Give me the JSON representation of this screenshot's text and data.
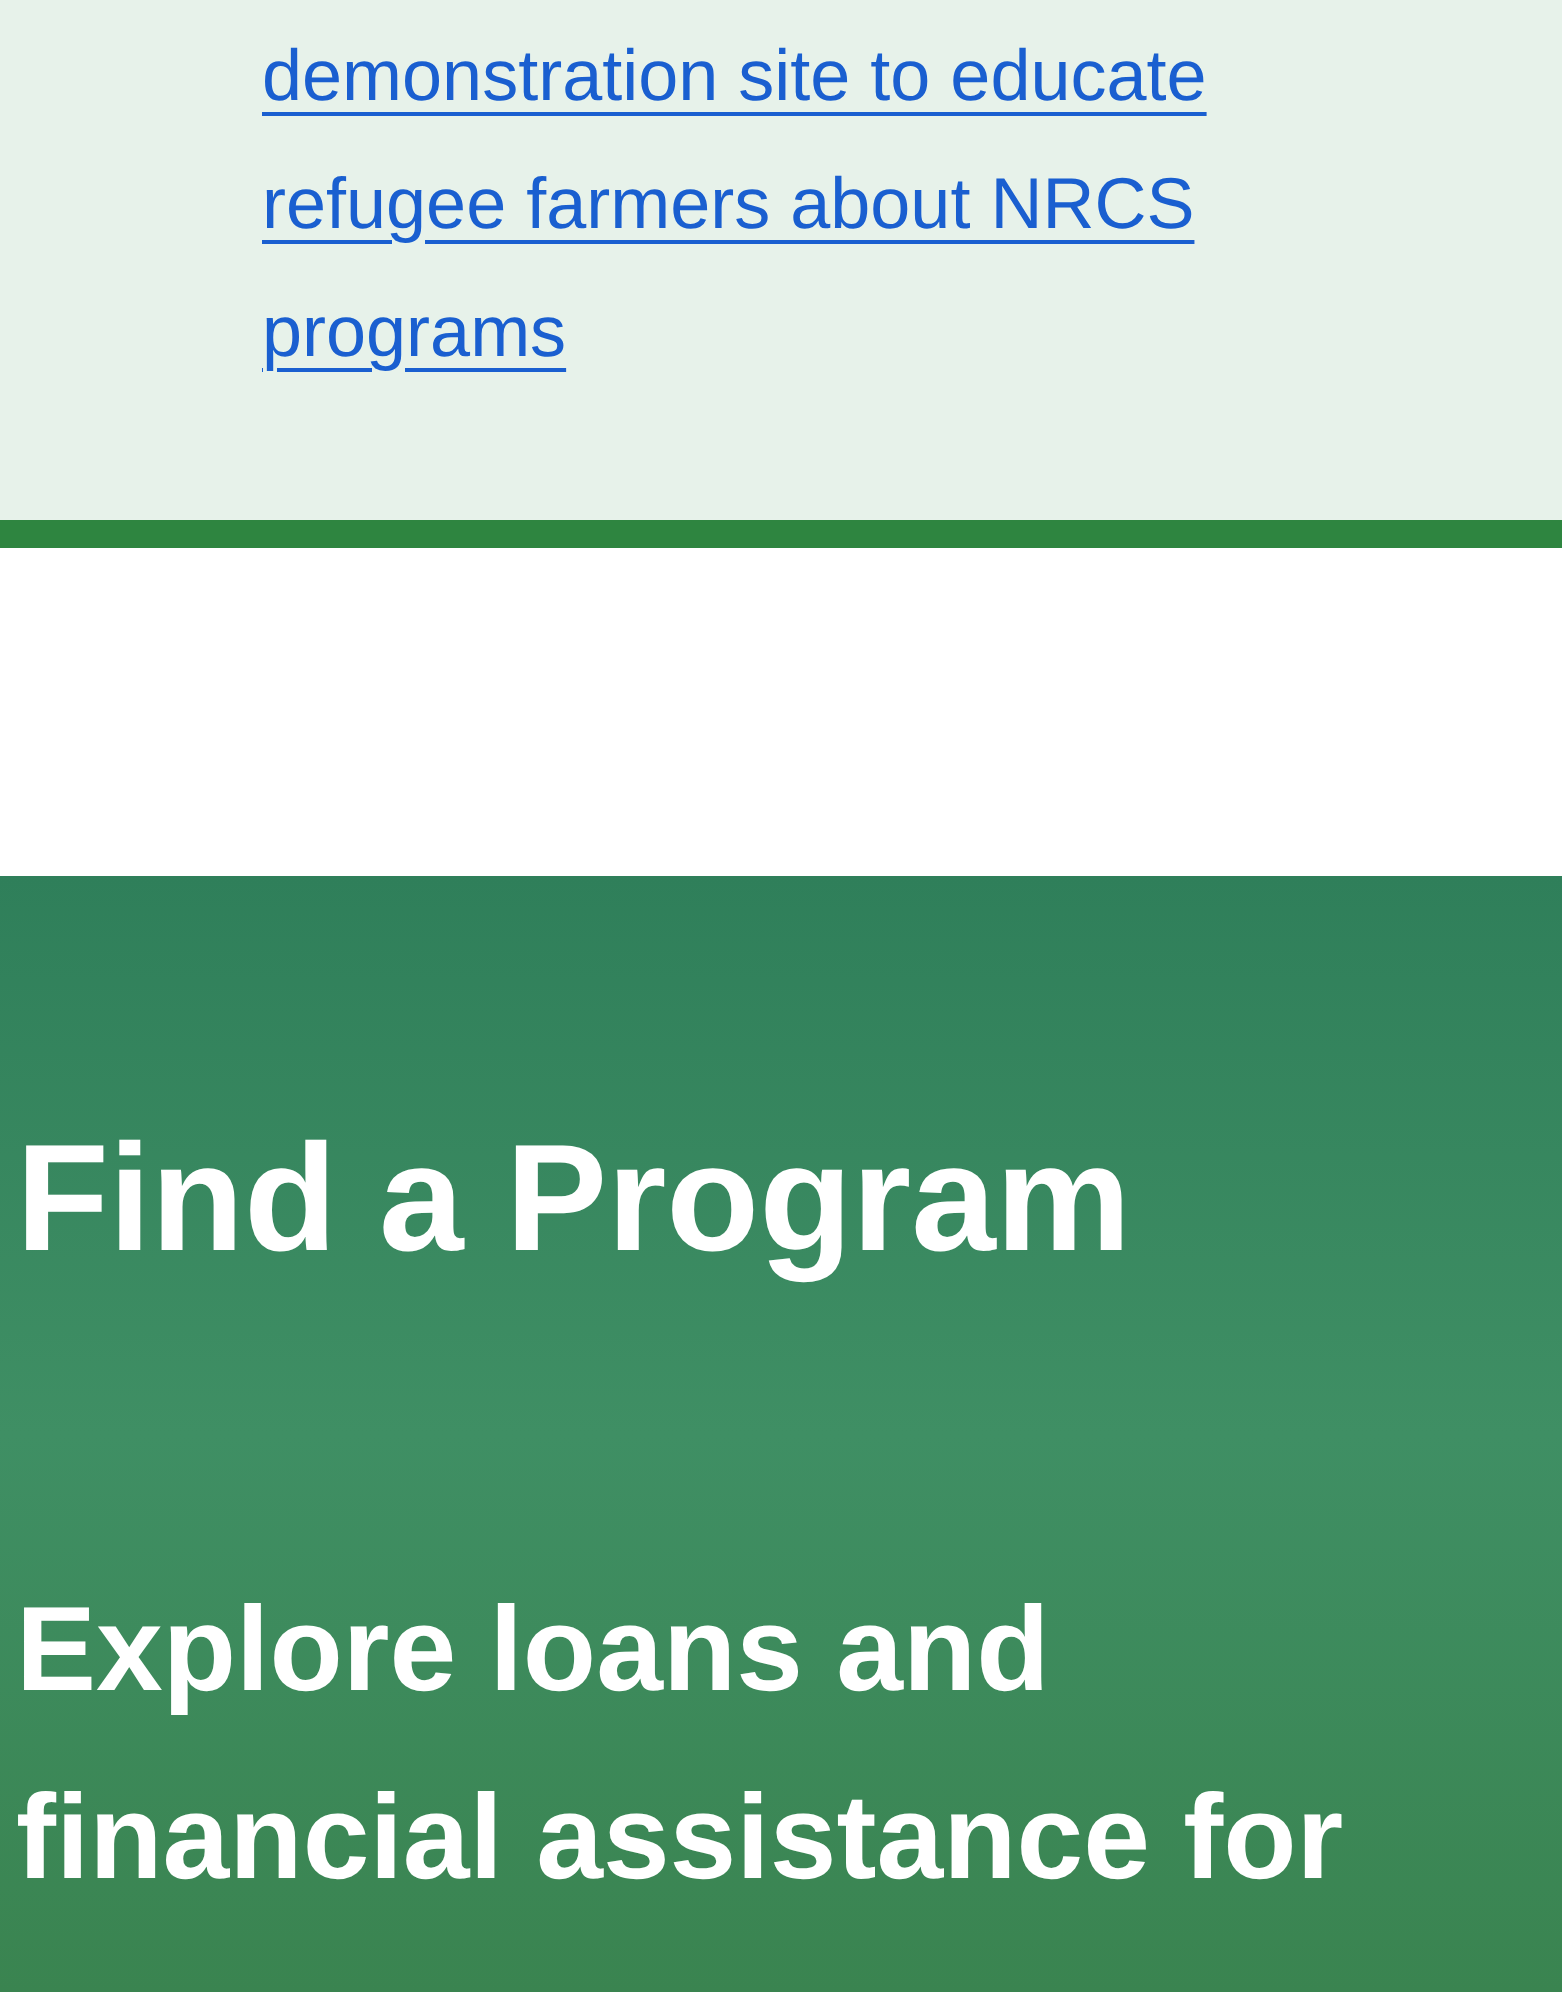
{
  "story_link": {
    "text": "demonstration site to educate refugee farmers about NRCS programs"
  },
  "hero": {
    "title": "Find a Program",
    "subtitle": "Explore loans and financial assistance for"
  }
}
